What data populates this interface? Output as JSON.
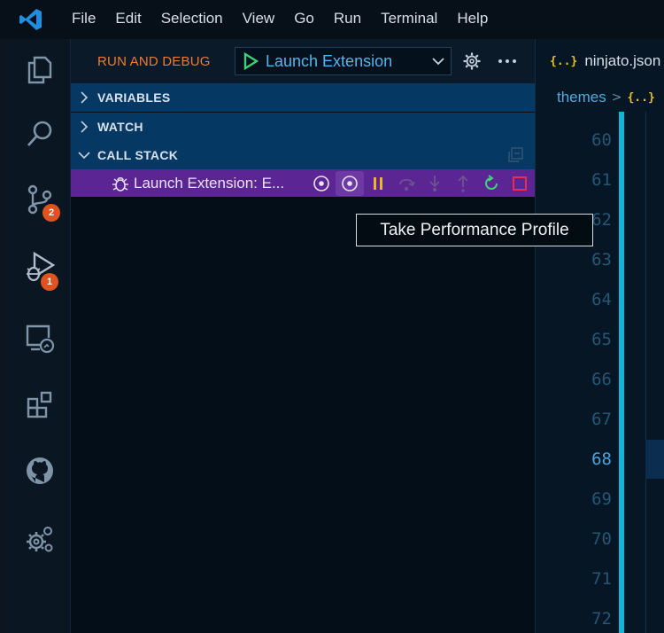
{
  "menu": [
    "File",
    "Edit",
    "Selection",
    "View",
    "Go",
    "Run",
    "Terminal",
    "Help"
  ],
  "activity_bar": {
    "items": [
      {
        "name": "explorer",
        "icon": "files-icon"
      },
      {
        "name": "search",
        "icon": "search-icon"
      },
      {
        "name": "source-control",
        "icon": "source-control-icon",
        "badge": "2"
      },
      {
        "name": "run-and-debug",
        "icon": "debug-icon",
        "badge": "1"
      },
      {
        "name": "remote-explorer",
        "icon": "remote-explorer-icon"
      },
      {
        "name": "extensions",
        "icon": "extensions-icon"
      },
      {
        "name": "github",
        "icon": "github-icon"
      },
      {
        "name": "manage",
        "icon": "gear-icon"
      }
    ]
  },
  "debug": {
    "title": "RUN AND DEBUG",
    "launch_config": "Launch Extension",
    "sections": {
      "variables": "VARIABLES",
      "watch": "WATCH",
      "call_stack": "CALL STACK"
    },
    "thread_label": "Launch Extension: E...",
    "tooltip": "Take Performance Profile"
  },
  "editor": {
    "tab_icon": "{..}",
    "tab_label": "ninjato.json",
    "breadcrumb_folder": "themes",
    "breadcrumb_sep": ">",
    "breadcrumb_file_icon": "{..}",
    "line_numbers": [
      "60",
      "61",
      "62",
      "63",
      "64",
      "65",
      "66",
      "67",
      "68",
      "69",
      "70",
      "71",
      "72"
    ],
    "current_line": "68"
  },
  "colors": {
    "debug_title": "#f07a32",
    "launch_label": "#4fb6ee",
    "section_header_bg": "#063864",
    "callstack_row_bg": "#5b2593",
    "pause": "#f0b429",
    "restart": "#3fd17a",
    "stop": "#f02a4a",
    "badge": "#e0531f",
    "gutter_bar": "#0fb6da"
  }
}
